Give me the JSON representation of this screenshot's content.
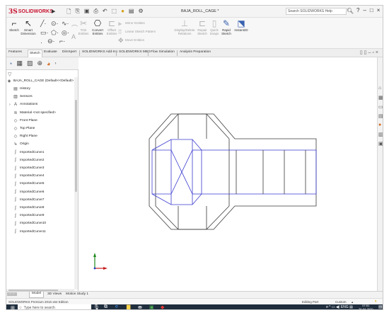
{
  "titlebar": {
    "brand": "SOLIDWORKS",
    "ds_mark": "3S",
    "doc_title": "BAJA_ROLL_CAGE *",
    "help_search_placeholder": "Search SOLIDWORKS Help",
    "quick_icons": [
      "new-icon",
      "open-icon",
      "save-icon",
      "print-icon",
      "undo-icon",
      "select-icon",
      "rebuild-icon",
      "options-icon"
    ]
  },
  "command_manager": {
    "sketch": "Sketch",
    "smart_dimension": "Smart Dimension",
    "trim_entities": "Trim Entities",
    "convert_entities": "Convert Entities",
    "offset_entities": "Offset Entities",
    "mirror_entities": "Mirror Entities",
    "linear_sketch_pattern": "Linear Sketch Pattern",
    "move_entities": "Move Entities",
    "display_delete_relations": "Display/Delete Relations",
    "repair_sketch": "Repair Sketch",
    "quick_snaps": "Quick Snaps",
    "rapid_sketch": "Rapid Sketch",
    "instant2d": "Instant2D"
  },
  "tabs": [
    "Features",
    "Sketch",
    "Evaluate",
    "DimXpert",
    "SOLIDWORKS Add-Ins",
    "SOLIDWORKS MBD",
    "Flow Simulation",
    "Analysis Preparation"
  ],
  "active_tab": "Sketch",
  "feature_tree": {
    "root": "BAJA_ROLL_CAGE  (Default<<Default>",
    "items": [
      {
        "label": "History",
        "icon": "folder-icon"
      },
      {
        "label": "Sensors",
        "icon": "sensor-icon"
      },
      {
        "label": "Annotations",
        "icon": "annotation-icon"
      },
      {
        "label": "Material <not specified>",
        "icon": "material-icon"
      },
      {
        "label": "Front Plane",
        "icon": "plane-icon"
      },
      {
        "label": "Top Plane",
        "icon": "plane-icon"
      },
      {
        "label": "Right Plane",
        "icon": "plane-icon"
      },
      {
        "label": "Origin",
        "icon": "origin-icon"
      },
      {
        "label": "ImportedCurve1",
        "icon": "curve-icon"
      },
      {
        "label": "ImportedCurve2",
        "icon": "curve-icon"
      },
      {
        "label": "ImportedCurve3",
        "icon": "curve-icon"
      },
      {
        "label": "ImportedCurve4",
        "icon": "curve-icon"
      },
      {
        "label": "ImportedCurve5",
        "icon": "curve-icon"
      },
      {
        "label": "ImportedCurve6",
        "icon": "curve-icon"
      },
      {
        "label": "ImportedCurve7",
        "icon": "curve-icon"
      },
      {
        "label": "ImportedCurve8",
        "icon": "curve-icon"
      },
      {
        "label": "ImportedCurve9",
        "icon": "curve-icon"
      },
      {
        "label": "ImportedCurve10",
        "icon": "curve-icon"
      },
      {
        "label": "ImportedCurve11",
        "icon": "curve-icon"
      }
    ]
  },
  "model_tabs": [
    "Model",
    "3D Views",
    "Motion Study 1"
  ],
  "active_model_tab": "Model",
  "status": {
    "edition": "SOLIDWORKS Premium 2016 x64 Edition",
    "mode": "Editing Part",
    "units": "Custom"
  },
  "taskbar": {
    "search_placeholder": "Type here to search",
    "time": "07:51",
    "date": "26-04-2020"
  },
  "colors": {
    "brand_red": "#c8102e",
    "sketch_blue": "#3a3ad0",
    "edge_dark": "#3a3a3a",
    "taskbar": "#1f2d3d"
  }
}
